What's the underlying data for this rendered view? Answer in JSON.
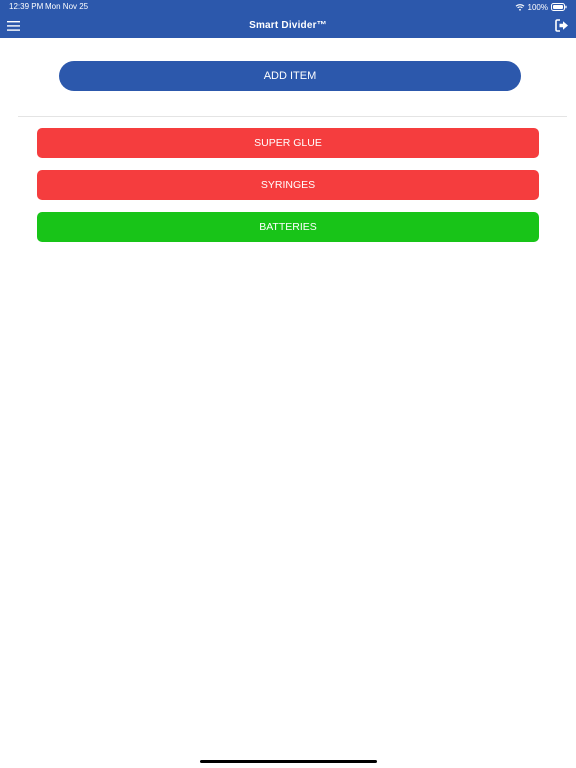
{
  "status_bar": {
    "time": "12:39 PM",
    "date": "Mon Nov 25",
    "battery_text": "100%",
    "icons": [
      "wifi-icon",
      "battery-icon"
    ]
  },
  "nav_bar": {
    "title": "Smart Divider™",
    "background_color": "#2c58ac",
    "left_icon": "hamburger-menu-icon",
    "right_icon": "logout-icon"
  },
  "main": {
    "add_button_label": "ADD ITEM",
    "items": [
      {
        "label": "SUPER GLUE",
        "color": "#f53d3e"
      },
      {
        "label": "SYRINGES",
        "color": "#f53d3e"
      },
      {
        "label": "BATTERIES",
        "color": "#18c418"
      }
    ]
  }
}
